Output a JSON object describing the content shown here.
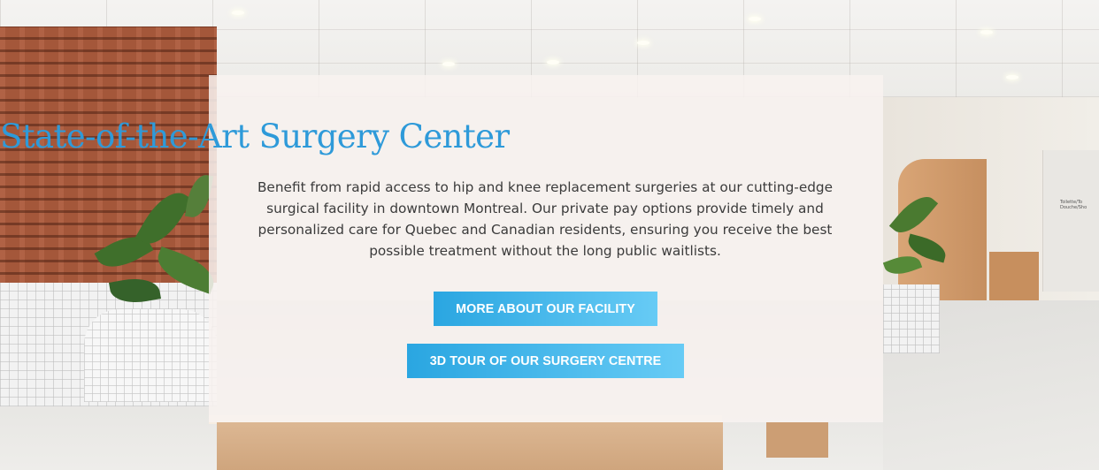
{
  "hero": {
    "title": "State-of-the-Art Surgery Center",
    "description": "Benefit from rapid access to hip and knee replacement surgeries at our cutting-edge surgical facility in downtown Montreal. Our private pay options provide timely and personalized care for Quebec and Canadian residents, ensuring you receive the best possible treatment without the long public waitlists.",
    "buttons": {
      "facility_label": "MORE ABOUT OUR FACILITY",
      "tour_label": "3D TOUR OF OUR SURGERY CENTRE"
    }
  },
  "background": {
    "sign_line1": "Toilette/To",
    "sign_line2": "Douche/Sho"
  },
  "colors": {
    "title": "#2e9ad9",
    "button_gradient_start": "#2aa6e1",
    "button_gradient_end": "#67cbf5",
    "card_overlay": "#f8f2f0"
  }
}
